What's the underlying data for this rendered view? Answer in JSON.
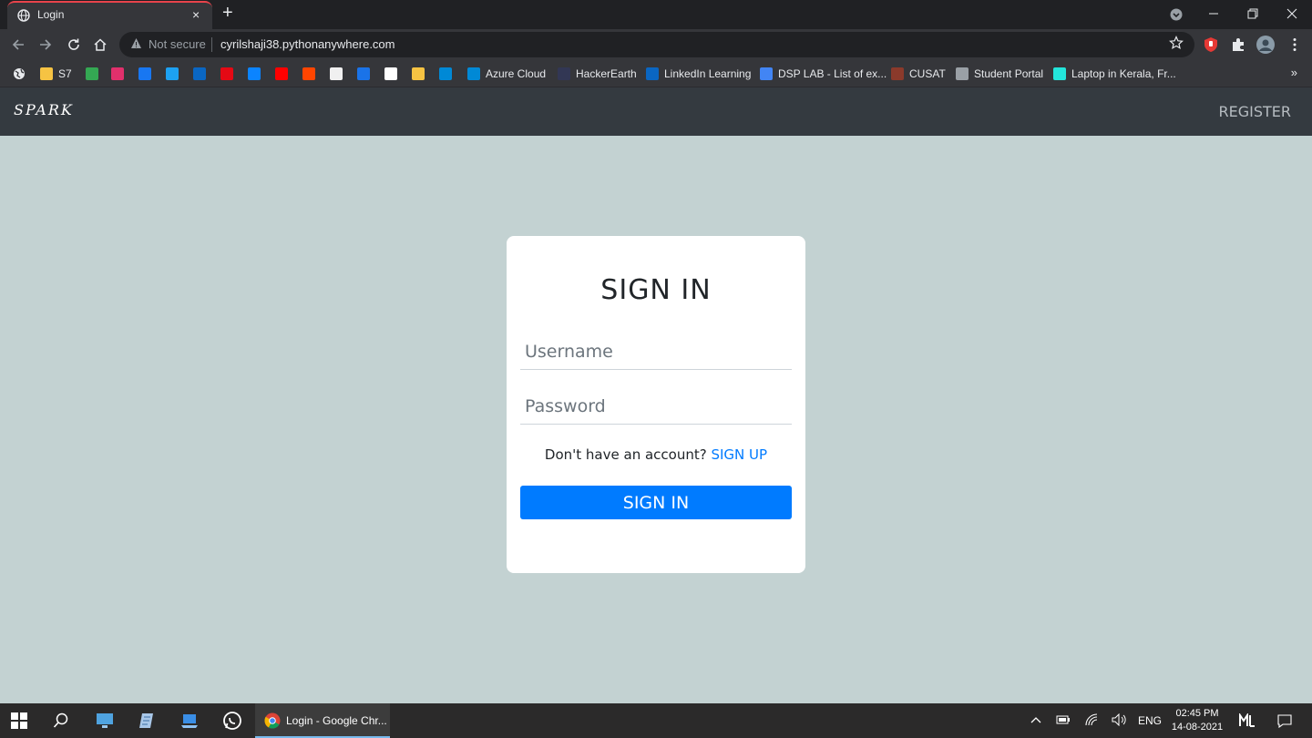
{
  "browser": {
    "tab_title": "Login",
    "tab_close": "×",
    "new_tab": "+",
    "security_label": "Not secure",
    "url": "cyrilshaji38.pythonanywhere.com",
    "bookmarks": [
      {
        "label": "S7",
        "color": "#f6c343"
      },
      {
        "label": "",
        "color": "#34a853"
      },
      {
        "label": "",
        "color": "#e1306c"
      },
      {
        "label": "",
        "color": "#1877f2"
      },
      {
        "label": "",
        "color": "#1da1f2"
      },
      {
        "label": "",
        "color": "#0a66c2"
      },
      {
        "label": "",
        "color": "#e50914"
      },
      {
        "label": "",
        "color": "#0b84ff"
      },
      {
        "label": "",
        "color": "#ff0000"
      },
      {
        "label": "",
        "color": "#ff4500"
      },
      {
        "label": "",
        "color": "#f0f0f0"
      },
      {
        "label": "",
        "color": "#1a73e8"
      },
      {
        "label": "",
        "color": "#ffffff"
      },
      {
        "label": "",
        "color": "#f6c343"
      },
      {
        "label": "",
        "color": "#0089d6"
      },
      {
        "label": "Azure Cloud",
        "color": "#0089d6"
      },
      {
        "label": "HackerEarth",
        "color": "#323754"
      },
      {
        "label": "LinkedIn Learning",
        "color": "#0a66c2"
      },
      {
        "label": "DSP LAB - List of ex...",
        "color": "#4285f4"
      },
      {
        "label": "CUSAT",
        "color": "#8b3a2b"
      },
      {
        "label": "Student Portal",
        "color": "#9aa0a6"
      },
      {
        "label": "Laptop in Kerala, Fr...",
        "color": "#23e5db"
      }
    ],
    "bookmarks_more": "»"
  },
  "navbar": {
    "brand": "SPARK",
    "register": "REGISTER"
  },
  "login": {
    "title": "SIGN IN",
    "username_placeholder": "Username",
    "password_placeholder": "Password",
    "signup_prompt": "Don't have an account?",
    "signup_link": "SIGN UP",
    "submit": "SIGN IN"
  },
  "taskbar": {
    "active_app": "Login - Google Chr...",
    "language": "ENG",
    "time": "02:45 PM",
    "date": "14-08-2021"
  }
}
